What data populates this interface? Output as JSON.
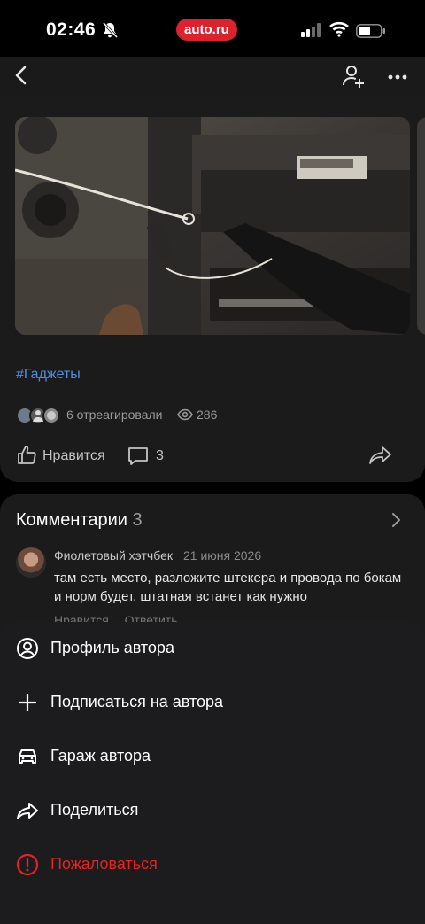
{
  "status_bar": {
    "time": "02:46",
    "app_pill": "auto.ru"
  },
  "post": {
    "hashtag": "#Гаджеты",
    "reactions_text": "6 отреагировали",
    "views": "286",
    "like_label": "Нравится",
    "comments_count": "3"
  },
  "comments": {
    "title": "Комментарии",
    "count": "3",
    "items": [
      {
        "author": "Фиолетовый хэтчбек",
        "date": "21 июня 2026",
        "text": "там есть место, разложите штекера и провода по бокам и норм будет, штатная встанет как нужно",
        "like_label": "Нравится",
        "reply_label": "Ответить"
      }
    ]
  },
  "menu": {
    "items": [
      {
        "label": "Профиль автора",
        "icon": "user-circle-icon"
      },
      {
        "label": "Подписаться на автора",
        "icon": "plus-icon"
      },
      {
        "label": "Гараж автора",
        "icon": "car-icon"
      },
      {
        "label": "Поделиться",
        "icon": "share-icon"
      },
      {
        "label": "Пожаловаться",
        "icon": "alert-icon",
        "color": "#e8231f"
      }
    ]
  },
  "colors": {
    "brand": "#d9232e",
    "link": "#4e8fe0",
    "danger": "#e8231f",
    "sheet_bg": "#1c1c1e"
  }
}
